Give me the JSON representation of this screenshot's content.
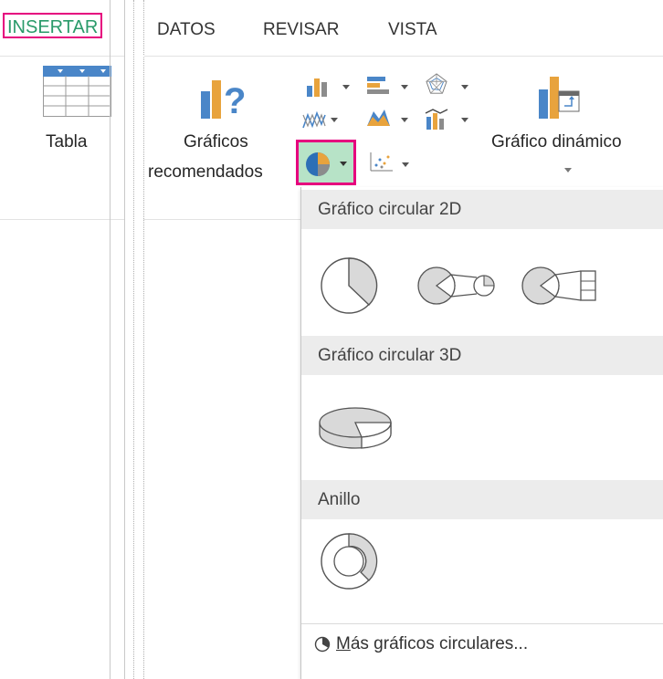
{
  "tabs": {
    "insertar": "INSERTAR",
    "datos": "DATOS",
    "revisar": "REVISAR",
    "vista": "VISTA"
  },
  "ribbon": {
    "table_label": "Tabla",
    "recommended_line1": "Gráficos",
    "recommended_line2": "recomendados",
    "pivot_chart_label": "Gráfico dinámico"
  },
  "chart_icons": [
    "column-chart-icon",
    "bar-chart-icon",
    "radar-chart-icon",
    "line-chart-icon",
    "area-chart-icon",
    "combo-chart-icon",
    "pie-chart-icon",
    "scatter-chart-icon"
  ],
  "dropdown": {
    "section_2d": "Gráfico circular 2D",
    "section_3d": "Gráfico circular 3D",
    "section_ring": "Anillo",
    "more_prefix": "M",
    "more_rest": "ás gráficos circulares..."
  },
  "colors": {
    "highlight": "#e6007e",
    "tab_active": "#2a9a6a",
    "pie_button_bg": "#b7e3c7",
    "pie_fill": "#d9d9d9"
  }
}
